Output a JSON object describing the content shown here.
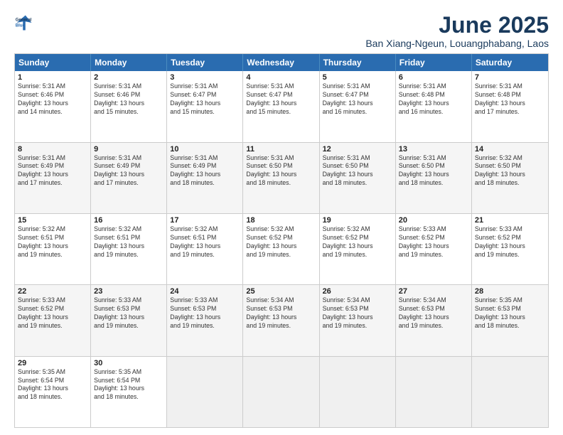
{
  "logo": {
    "line1": "General",
    "line2": "Blue"
  },
  "title": "June 2025",
  "subtitle": "Ban Xiang-Ngeun, Louangphabang, Laos",
  "header_days": [
    "Sunday",
    "Monday",
    "Tuesday",
    "Wednesday",
    "Thursday",
    "Friday",
    "Saturday"
  ],
  "rows": [
    [
      {
        "day": "1",
        "info": "Sunrise: 5:31 AM\nSunset: 6:46 PM\nDaylight: 13 hours\nand 14 minutes."
      },
      {
        "day": "2",
        "info": "Sunrise: 5:31 AM\nSunset: 6:46 PM\nDaylight: 13 hours\nand 15 minutes."
      },
      {
        "day": "3",
        "info": "Sunrise: 5:31 AM\nSunset: 6:47 PM\nDaylight: 13 hours\nand 15 minutes."
      },
      {
        "day": "4",
        "info": "Sunrise: 5:31 AM\nSunset: 6:47 PM\nDaylight: 13 hours\nand 15 minutes."
      },
      {
        "day": "5",
        "info": "Sunrise: 5:31 AM\nSunset: 6:47 PM\nDaylight: 13 hours\nand 16 minutes."
      },
      {
        "day": "6",
        "info": "Sunrise: 5:31 AM\nSunset: 6:48 PM\nDaylight: 13 hours\nand 16 minutes."
      },
      {
        "day": "7",
        "info": "Sunrise: 5:31 AM\nSunset: 6:48 PM\nDaylight: 13 hours\nand 17 minutes."
      }
    ],
    [
      {
        "day": "8",
        "info": "Sunrise: 5:31 AM\nSunset: 6:49 PM\nDaylight: 13 hours\nand 17 minutes."
      },
      {
        "day": "9",
        "info": "Sunrise: 5:31 AM\nSunset: 6:49 PM\nDaylight: 13 hours\nand 17 minutes."
      },
      {
        "day": "10",
        "info": "Sunrise: 5:31 AM\nSunset: 6:49 PM\nDaylight: 13 hours\nand 18 minutes."
      },
      {
        "day": "11",
        "info": "Sunrise: 5:31 AM\nSunset: 6:50 PM\nDaylight: 13 hours\nand 18 minutes."
      },
      {
        "day": "12",
        "info": "Sunrise: 5:31 AM\nSunset: 6:50 PM\nDaylight: 13 hours\nand 18 minutes."
      },
      {
        "day": "13",
        "info": "Sunrise: 5:31 AM\nSunset: 6:50 PM\nDaylight: 13 hours\nand 18 minutes."
      },
      {
        "day": "14",
        "info": "Sunrise: 5:32 AM\nSunset: 6:50 PM\nDaylight: 13 hours\nand 18 minutes."
      }
    ],
    [
      {
        "day": "15",
        "info": "Sunrise: 5:32 AM\nSunset: 6:51 PM\nDaylight: 13 hours\nand 19 minutes."
      },
      {
        "day": "16",
        "info": "Sunrise: 5:32 AM\nSunset: 6:51 PM\nDaylight: 13 hours\nand 19 minutes."
      },
      {
        "day": "17",
        "info": "Sunrise: 5:32 AM\nSunset: 6:51 PM\nDaylight: 13 hours\nand 19 minutes."
      },
      {
        "day": "18",
        "info": "Sunrise: 5:32 AM\nSunset: 6:52 PM\nDaylight: 13 hours\nand 19 minutes."
      },
      {
        "day": "19",
        "info": "Sunrise: 5:32 AM\nSunset: 6:52 PM\nDaylight: 13 hours\nand 19 minutes."
      },
      {
        "day": "20",
        "info": "Sunrise: 5:33 AM\nSunset: 6:52 PM\nDaylight: 13 hours\nand 19 minutes."
      },
      {
        "day": "21",
        "info": "Sunrise: 5:33 AM\nSunset: 6:52 PM\nDaylight: 13 hours\nand 19 minutes."
      }
    ],
    [
      {
        "day": "22",
        "info": "Sunrise: 5:33 AM\nSunset: 6:52 PM\nDaylight: 13 hours\nand 19 minutes."
      },
      {
        "day": "23",
        "info": "Sunrise: 5:33 AM\nSunset: 6:53 PM\nDaylight: 13 hours\nand 19 minutes."
      },
      {
        "day": "24",
        "info": "Sunrise: 5:33 AM\nSunset: 6:53 PM\nDaylight: 13 hours\nand 19 minutes."
      },
      {
        "day": "25",
        "info": "Sunrise: 5:34 AM\nSunset: 6:53 PM\nDaylight: 13 hours\nand 19 minutes."
      },
      {
        "day": "26",
        "info": "Sunrise: 5:34 AM\nSunset: 6:53 PM\nDaylight: 13 hours\nand 19 minutes."
      },
      {
        "day": "27",
        "info": "Sunrise: 5:34 AM\nSunset: 6:53 PM\nDaylight: 13 hours\nand 19 minutes."
      },
      {
        "day": "28",
        "info": "Sunrise: 5:35 AM\nSunset: 6:53 PM\nDaylight: 13 hours\nand 18 minutes."
      }
    ],
    [
      {
        "day": "29",
        "info": "Sunrise: 5:35 AM\nSunset: 6:54 PM\nDaylight: 13 hours\nand 18 minutes."
      },
      {
        "day": "30",
        "info": "Sunrise: 5:35 AM\nSunset: 6:54 PM\nDaylight: 13 hours\nand 18 minutes."
      },
      {
        "day": "",
        "info": ""
      },
      {
        "day": "",
        "info": ""
      },
      {
        "day": "",
        "info": ""
      },
      {
        "day": "",
        "info": ""
      },
      {
        "day": "",
        "info": ""
      }
    ]
  ]
}
